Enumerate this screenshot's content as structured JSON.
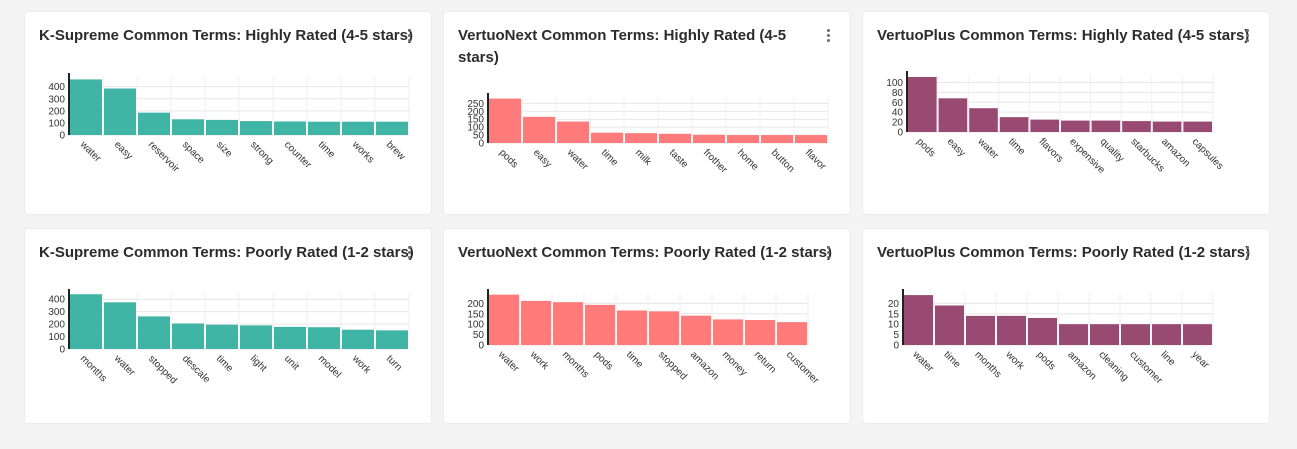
{
  "charts": [
    {
      "title": "K-Supreme Common Terms: Highly Rated (4-5 stars)",
      "color": "#40b5a6",
      "type": "bar",
      "categories": [
        "water",
        "easy",
        "reservoir",
        "space",
        "size",
        "strong",
        "counter",
        "time",
        "works",
        "brew"
      ],
      "values": [
        460,
        385,
        185,
        130,
        125,
        115,
        112,
        110,
        110,
        110
      ],
      "ylim": [
        0,
        480
      ],
      "yticks": [
        0,
        100,
        200,
        300,
        400
      ]
    },
    {
      "title": "VertuoNext Common Terms: Highly Rated (4-5 stars)",
      "color": "#ff7b7b",
      "type": "bar",
      "categories": [
        "pods",
        "easy",
        "water",
        "time",
        "milk",
        "taste",
        "frother",
        "home",
        "button",
        "flavor"
      ],
      "values": [
        280,
        165,
        135,
        65,
        62,
        58,
        52,
        50,
        50,
        50
      ],
      "ylim": [
        0,
        290
      ],
      "yticks": [
        0,
        50,
        100,
        150,
        200,
        250
      ]
    },
    {
      "title": "VertuoPlus Common Terms: Highly Rated (4-5 stars)",
      "color": "#984a72",
      "type": "bar",
      "categories": [
        "pods",
        "easy",
        "water",
        "time",
        "flavors",
        "expensive",
        "quality",
        "starbucks",
        "amazon",
        "capsules"
      ],
      "values": [
        111,
        68,
        48,
        30,
        25,
        23,
        23,
        22,
        21,
        21
      ],
      "ylim": [
        0,
        115
      ],
      "yticks": [
        0,
        20,
        40,
        60,
        80,
        100
      ]
    },
    {
      "title": "K-Supreme Common Terms: Poorly Rated (1-2 stars)",
      "color": "#40b5a6",
      "type": "bar",
      "categories": [
        "months",
        "water",
        "stopped",
        "descale",
        "time",
        "light",
        "unit",
        "model",
        "work",
        "turn"
      ],
      "values": [
        440,
        375,
        262,
        205,
        195,
        190,
        178,
        175,
        155,
        150
      ],
      "ylim": [
        0,
        450
      ],
      "yticks": [
        0,
        100,
        200,
        300,
        400
      ]
    },
    {
      "title": "VertuoNext Common Terms: Poorly Rated (1-2 stars)",
      "color": "#ff7b7b",
      "type": "bar",
      "categories": [
        "water",
        "work",
        "months",
        "pods",
        "time",
        "stopped",
        "amazon",
        "money",
        "return",
        "customer"
      ],
      "values": [
        242,
        212,
        206,
        193,
        166,
        162,
        141,
        123,
        120,
        110
      ],
      "ylim": [
        0,
        250
      ],
      "yticks": [
        0,
        50,
        100,
        150,
        200
      ]
    },
    {
      "title": "VertuoPlus Common Terms: Poorly Rated (1-2 stars)",
      "color": "#984a72",
      "type": "bar",
      "categories": [
        "water",
        "time",
        "months",
        "work",
        "pods",
        "amazon",
        "cleaning",
        "customer",
        "line",
        "year"
      ],
      "values": [
        24,
        19,
        14,
        14,
        13,
        10,
        10,
        10,
        10,
        10
      ],
      "ylim": [
        0,
        25
      ],
      "yticks": [
        0,
        5,
        10,
        15,
        20
      ]
    }
  ]
}
